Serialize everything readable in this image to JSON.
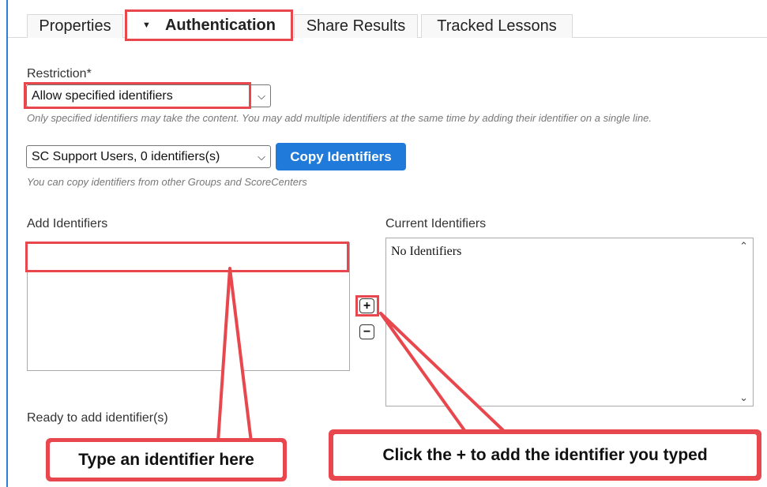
{
  "tabs": [
    {
      "label": "Properties"
    },
    {
      "label": "Authentication"
    },
    {
      "label": "Share Results"
    },
    {
      "label": "Tracked Lessons"
    }
  ],
  "restriction": {
    "label": "Restriction*",
    "selected": "Allow specified identifiers",
    "help": "Only specified identifiers may take the content. You may add multiple identifiers at the same time by adding their identifier on a single line."
  },
  "copy": {
    "selected": "SC Support Users, 0 identifiers(s)",
    "button": "Copy Identifiers",
    "help": "You can copy identifiers from other Groups and ScoreCenters"
  },
  "add": {
    "label": "Add Identifiers",
    "value": "",
    "status": "Ready to add identifier(s)"
  },
  "current": {
    "label": "Current Identifiers",
    "items": [
      "No Identifiers"
    ]
  },
  "buttons": {
    "plus": "+",
    "minus": "−"
  },
  "callouts": {
    "left": "Type an identifier here",
    "right": "Click the + to add the identifier you typed"
  },
  "colors": {
    "accent": "#1f7ad9",
    "highlight": "#e8474d",
    "frame": "#2b7fd6"
  }
}
